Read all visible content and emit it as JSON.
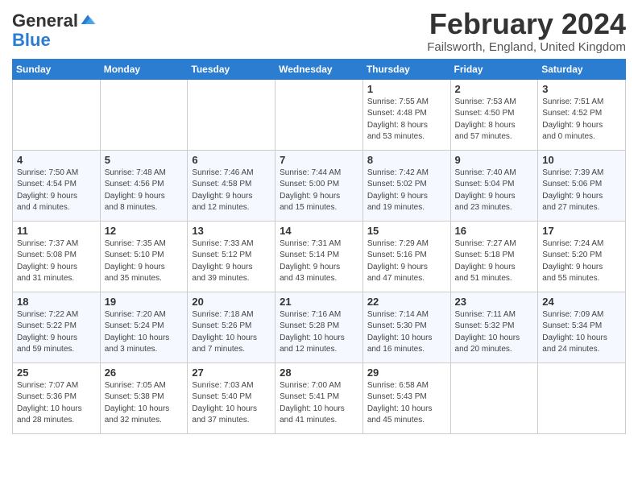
{
  "logo": {
    "line1": "General",
    "line2": "Blue"
  },
  "title": "February 2024",
  "location": "Failsworth, England, United Kingdom",
  "days_of_week": [
    "Sunday",
    "Monday",
    "Tuesday",
    "Wednesday",
    "Thursday",
    "Friday",
    "Saturday"
  ],
  "weeks": [
    [
      {
        "day": "",
        "info": ""
      },
      {
        "day": "",
        "info": ""
      },
      {
        "day": "",
        "info": ""
      },
      {
        "day": "",
        "info": ""
      },
      {
        "day": "1",
        "info": "Sunrise: 7:55 AM\nSunset: 4:48 PM\nDaylight: 8 hours\nand 53 minutes."
      },
      {
        "day": "2",
        "info": "Sunrise: 7:53 AM\nSunset: 4:50 PM\nDaylight: 8 hours\nand 57 minutes."
      },
      {
        "day": "3",
        "info": "Sunrise: 7:51 AM\nSunset: 4:52 PM\nDaylight: 9 hours\nand 0 minutes."
      }
    ],
    [
      {
        "day": "4",
        "info": "Sunrise: 7:50 AM\nSunset: 4:54 PM\nDaylight: 9 hours\nand 4 minutes."
      },
      {
        "day": "5",
        "info": "Sunrise: 7:48 AM\nSunset: 4:56 PM\nDaylight: 9 hours\nand 8 minutes."
      },
      {
        "day": "6",
        "info": "Sunrise: 7:46 AM\nSunset: 4:58 PM\nDaylight: 9 hours\nand 12 minutes."
      },
      {
        "day": "7",
        "info": "Sunrise: 7:44 AM\nSunset: 5:00 PM\nDaylight: 9 hours\nand 15 minutes."
      },
      {
        "day": "8",
        "info": "Sunrise: 7:42 AM\nSunset: 5:02 PM\nDaylight: 9 hours\nand 19 minutes."
      },
      {
        "day": "9",
        "info": "Sunrise: 7:40 AM\nSunset: 5:04 PM\nDaylight: 9 hours\nand 23 minutes."
      },
      {
        "day": "10",
        "info": "Sunrise: 7:39 AM\nSunset: 5:06 PM\nDaylight: 9 hours\nand 27 minutes."
      }
    ],
    [
      {
        "day": "11",
        "info": "Sunrise: 7:37 AM\nSunset: 5:08 PM\nDaylight: 9 hours\nand 31 minutes."
      },
      {
        "day": "12",
        "info": "Sunrise: 7:35 AM\nSunset: 5:10 PM\nDaylight: 9 hours\nand 35 minutes."
      },
      {
        "day": "13",
        "info": "Sunrise: 7:33 AM\nSunset: 5:12 PM\nDaylight: 9 hours\nand 39 minutes."
      },
      {
        "day": "14",
        "info": "Sunrise: 7:31 AM\nSunset: 5:14 PM\nDaylight: 9 hours\nand 43 minutes."
      },
      {
        "day": "15",
        "info": "Sunrise: 7:29 AM\nSunset: 5:16 PM\nDaylight: 9 hours\nand 47 minutes."
      },
      {
        "day": "16",
        "info": "Sunrise: 7:27 AM\nSunset: 5:18 PM\nDaylight: 9 hours\nand 51 minutes."
      },
      {
        "day": "17",
        "info": "Sunrise: 7:24 AM\nSunset: 5:20 PM\nDaylight: 9 hours\nand 55 minutes."
      }
    ],
    [
      {
        "day": "18",
        "info": "Sunrise: 7:22 AM\nSunset: 5:22 PM\nDaylight: 9 hours\nand 59 minutes."
      },
      {
        "day": "19",
        "info": "Sunrise: 7:20 AM\nSunset: 5:24 PM\nDaylight: 10 hours\nand 3 minutes."
      },
      {
        "day": "20",
        "info": "Sunrise: 7:18 AM\nSunset: 5:26 PM\nDaylight: 10 hours\nand 7 minutes."
      },
      {
        "day": "21",
        "info": "Sunrise: 7:16 AM\nSunset: 5:28 PM\nDaylight: 10 hours\nand 12 minutes."
      },
      {
        "day": "22",
        "info": "Sunrise: 7:14 AM\nSunset: 5:30 PM\nDaylight: 10 hours\nand 16 minutes."
      },
      {
        "day": "23",
        "info": "Sunrise: 7:11 AM\nSunset: 5:32 PM\nDaylight: 10 hours\nand 20 minutes."
      },
      {
        "day": "24",
        "info": "Sunrise: 7:09 AM\nSunset: 5:34 PM\nDaylight: 10 hours\nand 24 minutes."
      }
    ],
    [
      {
        "day": "25",
        "info": "Sunrise: 7:07 AM\nSunset: 5:36 PM\nDaylight: 10 hours\nand 28 minutes."
      },
      {
        "day": "26",
        "info": "Sunrise: 7:05 AM\nSunset: 5:38 PM\nDaylight: 10 hours\nand 32 minutes."
      },
      {
        "day": "27",
        "info": "Sunrise: 7:03 AM\nSunset: 5:40 PM\nDaylight: 10 hours\nand 37 minutes."
      },
      {
        "day": "28",
        "info": "Sunrise: 7:00 AM\nSunset: 5:41 PM\nDaylight: 10 hours\nand 41 minutes."
      },
      {
        "day": "29",
        "info": "Sunrise: 6:58 AM\nSunset: 5:43 PM\nDaylight: 10 hours\nand 45 minutes."
      },
      {
        "day": "",
        "info": ""
      },
      {
        "day": "",
        "info": ""
      }
    ]
  ]
}
